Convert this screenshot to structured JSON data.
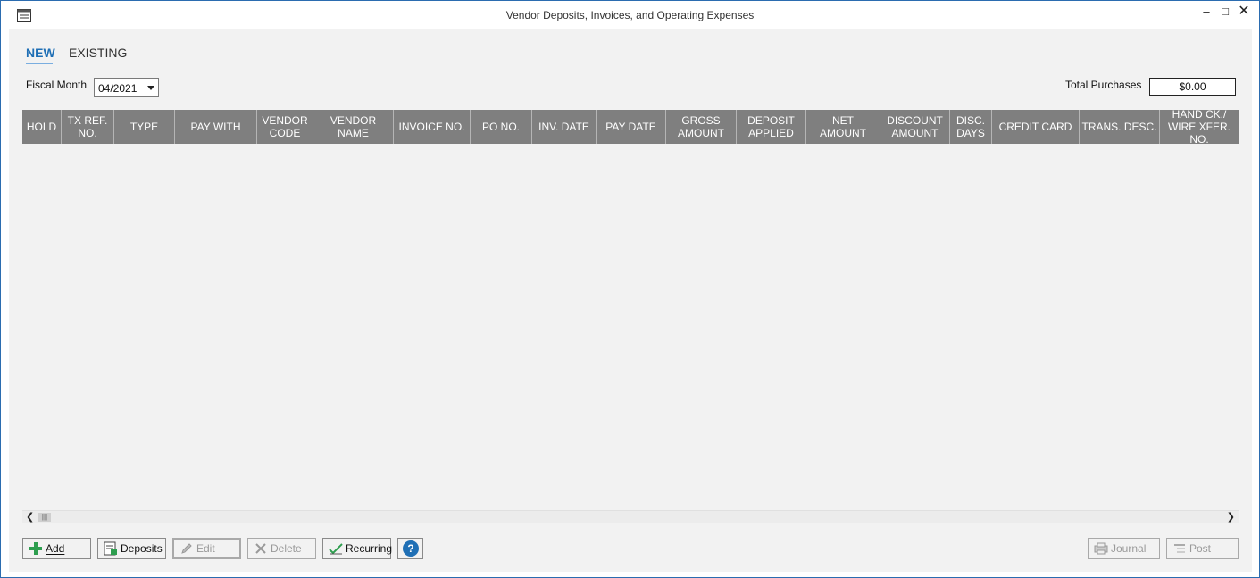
{
  "window": {
    "title": "Vendor Deposits, Invoices, and Operating Expenses",
    "minimize": "–",
    "maximize": "□",
    "close": "✕"
  },
  "tabs": [
    {
      "label": "NEW",
      "active": true
    },
    {
      "label": "EXISTING",
      "active": false
    }
  ],
  "filters": {
    "fiscal_month_label": "Fiscal Month",
    "fiscal_month_value": "04/2021",
    "total_purchases_label": "Total Purchases",
    "total_purchases_value": "$0.00"
  },
  "grid": {
    "columns": [
      "HOLD",
      "TX REF.\nNO.",
      "TYPE",
      "PAY WITH",
      "VENDOR\nCODE",
      "VENDOR NAME",
      "INVOICE NO.",
      "PO NO.",
      "INV. DATE",
      "PAY DATE",
      "GROSS\nAMOUNT",
      "DEPOSIT\nAPPLIED",
      "NET AMOUNT",
      "DISCOUNT\nAMOUNT",
      "DISC.\nDAYS",
      "CREDIT CARD",
      "TRANS. DESC.",
      "HAND CK./\nWIRE XFER. NO."
    ],
    "rows": []
  },
  "buttons": {
    "add": "Add",
    "deposits": "Deposits",
    "edit": "Edit",
    "delete": "Delete",
    "recurring": "Recurring",
    "help": "?",
    "journal": "Journal",
    "post": "Post"
  },
  "colors": {
    "accent": "#1f6fb5",
    "header_bg": "#7f7f7f",
    "panel_bg": "#f2f2f2",
    "add_icon": "#2e9e4f",
    "help_icon": "#1f6fb5"
  }
}
